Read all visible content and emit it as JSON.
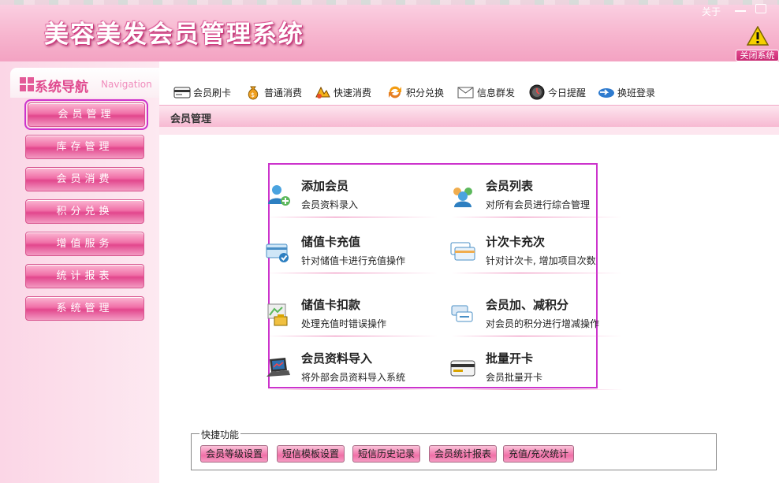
{
  "app": {
    "title": "美容美发会员管理系统",
    "about": "关于",
    "close_system": "关闭系统"
  },
  "sidebar": {
    "title": "系统导航",
    "title_en": "Navigation",
    "items": [
      {
        "label": "会员管理",
        "active": true
      },
      {
        "label": "库存管理"
      },
      {
        "label": "会员消费"
      },
      {
        "label": "积分兑换"
      },
      {
        "label": "增值服务"
      },
      {
        "label": "统计报表"
      },
      {
        "label": "系统管理"
      }
    ]
  },
  "toolbar": {
    "items": [
      {
        "label": "会员刷卡",
        "icon": "card-swipe-icon"
      },
      {
        "label": "普通消费",
        "icon": "money-bag-icon"
      },
      {
        "label": "快速消费",
        "icon": "quick-pay-icon"
      },
      {
        "label": "积分兑换",
        "icon": "exchange-arrows-icon"
      },
      {
        "label": "信息群发",
        "icon": "envelope-icon"
      },
      {
        "label": "今日提醒",
        "icon": "clock-icon"
      },
      {
        "label": "换班登录",
        "icon": "shift-login-icon"
      }
    ]
  },
  "breadcrumb": "会员管理",
  "functions": [
    {
      "title": "添加会员",
      "desc": "会员资料录入",
      "icon": "add-member-icon"
    },
    {
      "title": "会员列表",
      "desc": "对所有会员进行综合管理",
      "icon": "member-list-icon"
    },
    {
      "title": "储值卡充值",
      "desc": "针对储值卡进行充值操作",
      "icon": "card-recharge-icon"
    },
    {
      "title": "计次卡充次",
      "desc": "针对计次卡, 增加项目次数",
      "icon": "count-card-icon"
    },
    {
      "title": "储值卡扣款",
      "desc": "处理充值时错误操作",
      "icon": "card-deduct-icon"
    },
    {
      "title": "会员加、减积分",
      "desc": "对会员的积分进行增减操作",
      "icon": "points-adjust-icon"
    },
    {
      "title": "会员资料导入",
      "desc": "将外部会员资料导入系统",
      "icon": "laptop-import-icon"
    },
    {
      "title": "批量开卡",
      "desc": "会员批量开卡",
      "icon": "batch-card-icon"
    }
  ],
  "quick": {
    "legend": "快捷功能",
    "buttons": [
      "会员等级设置",
      "短信模板设置",
      "短信历史记录",
      "会员统计报表",
      "充值/充次统计"
    ]
  },
  "colors": {
    "accent": "#e2478d",
    "highlight_border": "#cc33cc",
    "header_pink": "#f7b6cf"
  }
}
